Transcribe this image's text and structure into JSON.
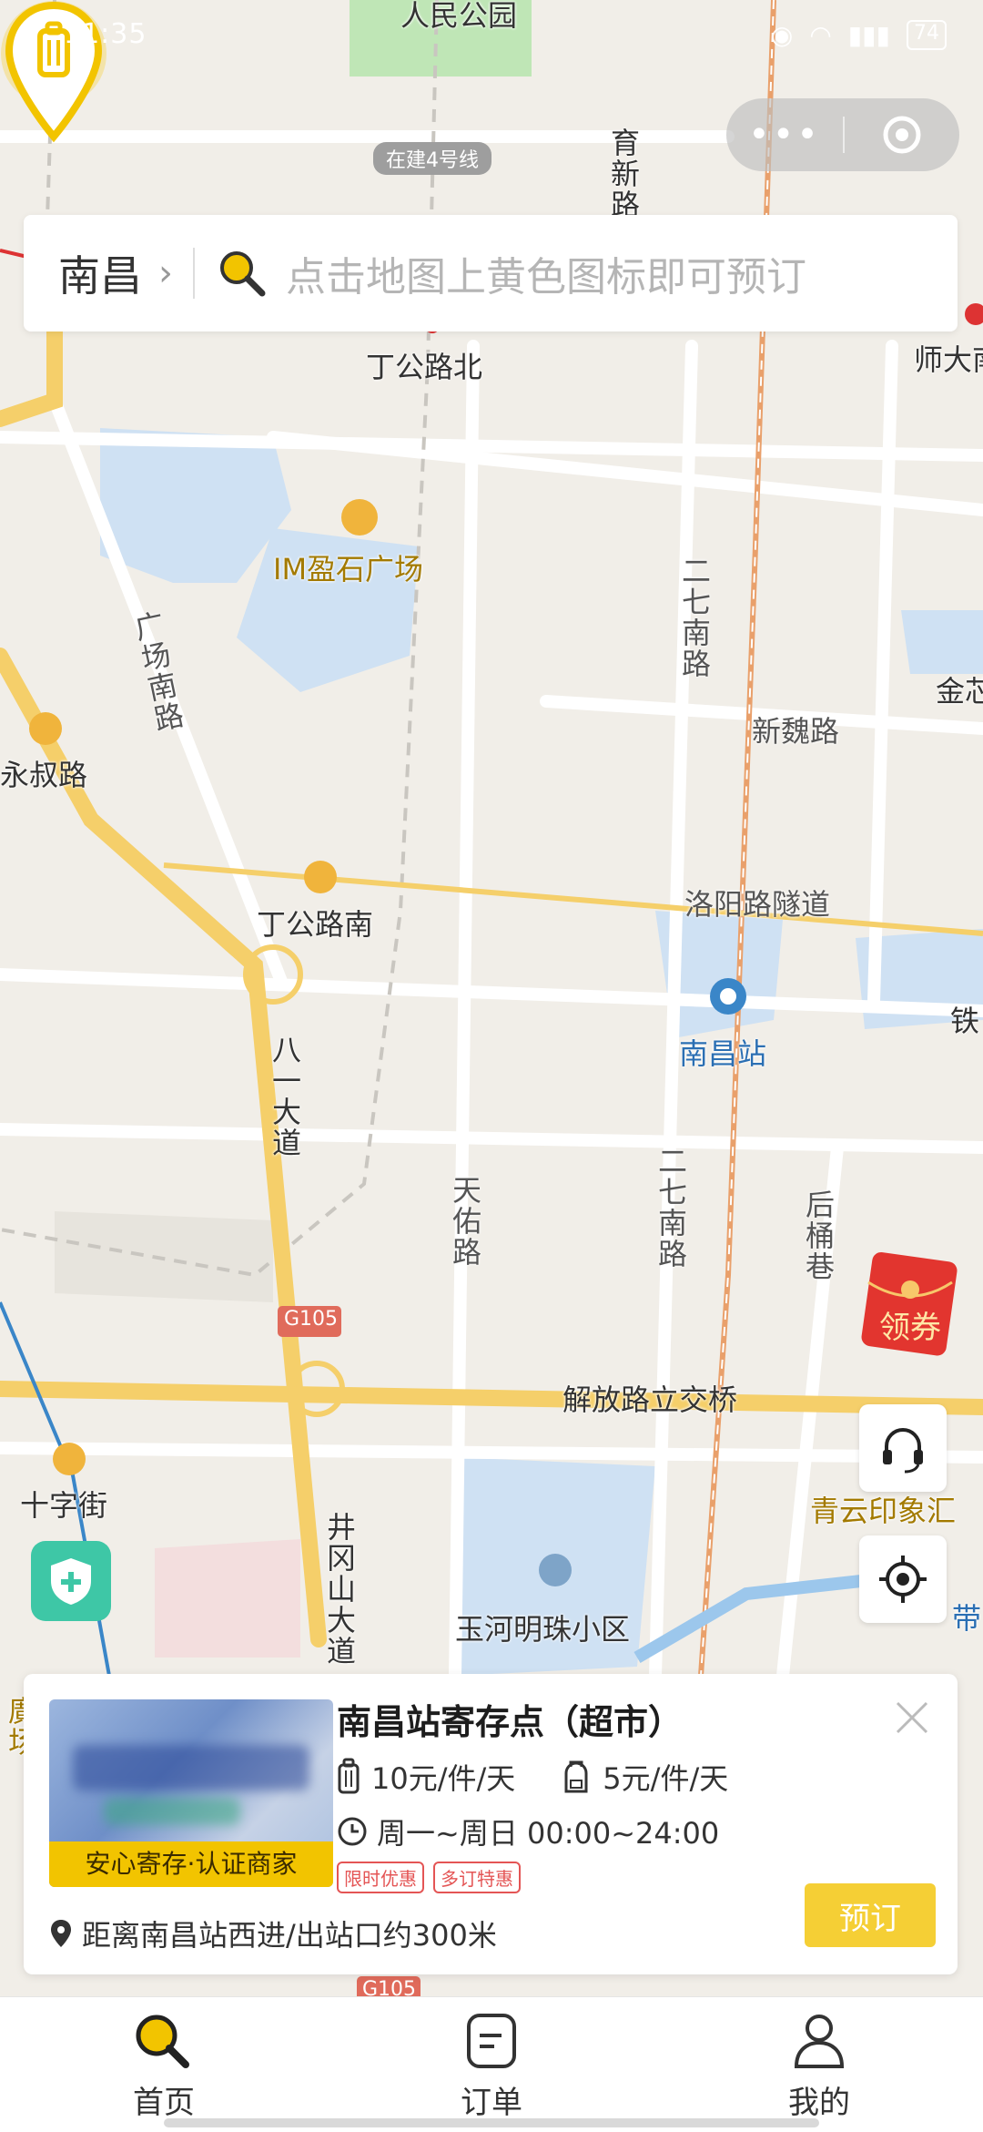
{
  "status_bar": {
    "time": "11:35",
    "battery": "74"
  },
  "capsule": {
    "more_icon": "more-dots-icon",
    "close_icon": "target-circle-icon"
  },
  "search": {
    "city": "南昌",
    "chevron": "›",
    "placeholder": "点击地图上黄色图标即可预订"
  },
  "map": {
    "labels": {
      "park": "人民公园",
      "metro_line": "在建4号线",
      "yuxin": "育新路",
      "dinggong_north": "丁公路北",
      "shida": "师大南",
      "im_plaza": "IM盈石广场",
      "erqi_road": "二七南路",
      "guangchang": "广场南路",
      "jinxin": "金芯",
      "xinwei": "新魏路",
      "yongshu": "永叔路",
      "luoyang": "洛阳路隧道",
      "dinggong_south": "丁公路南",
      "nanchang_station": "南昌站",
      "tie": "铁",
      "bayi": "八一大道",
      "tianyou": "天佑路",
      "erqi_road2": "二七南路",
      "houtong": "后桶巷",
      "g105": "G105",
      "jiefang": "解放路立交桥",
      "shizi": "十字街",
      "qingyun": "青云印象汇",
      "jinggang": "井冈山大道",
      "yuhe": "玉河明珠小区",
      "dai": "带",
      "guang": "廣场",
      "g105_bottom": "G105"
    },
    "pin_icon": "luggage-pin-icon"
  },
  "red_packet": {
    "label": "领券"
  },
  "fab": {
    "support_icon": "headset-icon",
    "locate_icon": "locate-icon"
  },
  "shield_icon": "shield-plus-icon",
  "card": {
    "title": "南昌站寄存点（超市）",
    "thumb_badge": "安心寄存·认证商家",
    "price_luggage": "10元/件/天",
    "price_bag": "5元/件/天",
    "hours": "周一~周日 00:00~24:00",
    "tags": [
      "限时优惠",
      "多订特惠"
    ],
    "distance": "距离南昌站西进/出站口约300米",
    "book_label": "预订"
  },
  "tabbar": {
    "tabs": [
      {
        "label": "首页",
        "icon": "search-icon",
        "active": true
      },
      {
        "label": "订单",
        "icon": "order-icon",
        "active": false
      },
      {
        "label": "我的",
        "icon": "user-icon",
        "active": false
      }
    ]
  },
  "colors": {
    "accent": "#f2c400",
    "book": "#f5cf35",
    "tag": "#e45555",
    "shield": "#3ec7a6"
  }
}
